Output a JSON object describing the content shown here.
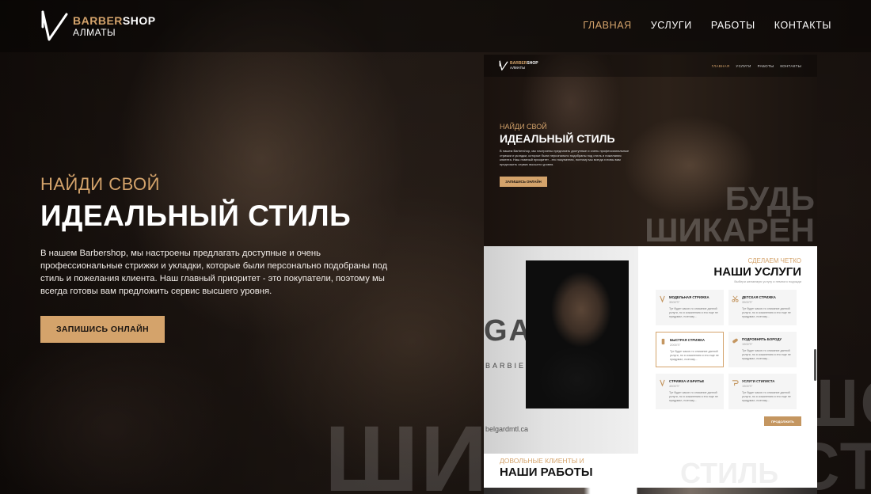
{
  "header": {
    "logo_top_bold": "BARBER",
    "logo_top_rest": "SHOP",
    "logo_sub": "АЛМАТЫ",
    "nav": [
      "ГЛАВНАЯ",
      "УСЛУГИ",
      "РАБОТЫ",
      "КОНТАКТЫ"
    ]
  },
  "hero": {
    "kicker": "НАЙДИ СВОЙ",
    "title": "ИДЕАЛЬНЫЙ СТИЛЬ",
    "lead": "В нашем Barbershop, мы настроены предлагать доступные и очень профессиональные стрижки и укладки, которые были персонально подобраны под стиль и пожелания клиента. Наш главный приоритет - это покупатели, поэтому мы всегда готовы вам предложить сервис высшего уровня.",
    "cta": "ЗАПИШИСЬ ОНЛАЙН",
    "bg_word": "ШИК"
  },
  "bg_right_word": "ШОР СТИЛЬ",
  "mockup": {
    "logo_top_bold": "BARBER",
    "logo_top_rest": "SHOP",
    "logo_sub": "АЛМАТЫ",
    "nav": [
      "ГЛАВНАЯ",
      "УСЛУГИ",
      "РАБОТЫ",
      "КОНТАКТЫ"
    ],
    "kicker": "НАЙДИ СВОЙ",
    "title": "ИДЕАЛЬНЫЙ СТИЛЬ",
    "lead": "В нашем Barbershop, мы настроены предлагать доступные и очень профессиональные стрижки и укладки, которые были персонально подобраны под стиль и пожелания клиента. Наш главный приоритет - это покупатели, поэтому мы всегда готовы вам предложить сервис высшего уровня.",
    "cta": "ЗАПИШИСЬ ОНЛАЙН",
    "big_line1": "БУДЬ",
    "big_line2": "ШИКАРЕН",
    "photo_text_ga": "GA",
    "photo_text_barbier": "BARBIER",
    "photo_url": "belgardmtl.ca",
    "services": {
      "kicker": "СДЕЛАЕМ ЧЕТКО",
      "title": "НАШИ УСЛУГИ",
      "subtitle": "Выбери желаемую услугу и немного подожди",
      "items": [
        {
          "name": "МОДЕЛЬНАЯ СТРИЖКА",
          "price": "3500ТГ",
          "desc": "Тут будет какое-то описание данной услуги, но я сожалению я его еще не придумал, поэтому...",
          "icon": "razor-icon",
          "highlighted": false
        },
        {
          "name": "ДЕТСКАЯ СТРИЖКА",
          "price": "3500ТГ",
          "desc": "Тут будет какое-то описание данной услуги, но я сожалению я его еще не придумал, поэтому...",
          "icon": "scissors-icon",
          "highlighted": false
        },
        {
          "name": "БЫСТРАЯ СТРИЖКА",
          "price": "2000ТГ",
          "desc": "Тут будет какое-то описание данной услуги, но я сожалению я его еще не придумал, поэтому...",
          "icon": "clipper-icon",
          "highlighted": true
        },
        {
          "name": "ПОДРОВНЯТЬ БОРОДУ",
          "price": "1500ТГ",
          "desc": "Тут будет какое-то описание данной услуги, но я сожалению я его еще не придумал, поэтому...",
          "icon": "comb-icon",
          "highlighted": false
        },
        {
          "name": "СТРИЖКА И БРИТЬЕ",
          "price": "4500ТГ",
          "desc": "Тут будет какое-то описание данной услуги, но я сожалению я его еще не придумал, поэтому...",
          "icon": "razor-icon",
          "highlighted": false
        },
        {
          "name": "УСЛУГИ СТИЛИСТА",
          "price": "1500ТГ",
          "desc": "Тут будет какое-то описание данной услуги, но я сожалению я его еще не придумал, поэтому...",
          "icon": "hairdryer-icon",
          "highlighted": false
        }
      ],
      "more": "ПРОДОЛЖИТЬ"
    },
    "works": {
      "kicker": "ДОВОЛЬНЫЕ КЛИЕНТЫ И",
      "title": "НАШИ РАБОТЫ",
      "big_word": "СТИЛЬ"
    }
  },
  "colors": {
    "accent": "#d4a36b",
    "dark": "#1b1410"
  }
}
